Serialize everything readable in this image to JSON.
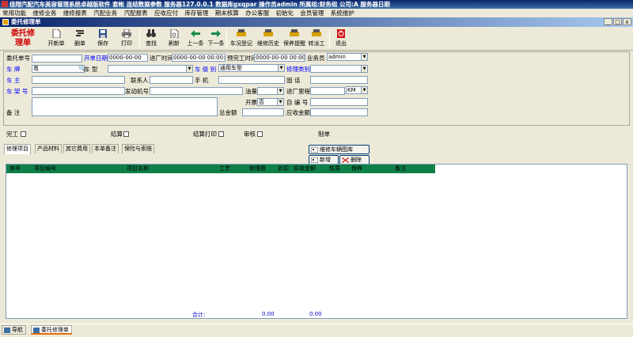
{
  "titlebar": {
    "text": "佳翔汽配汽车美容管理系统卓越版软件   套帐 连结数据参数    服务器127.0.0.1   数据库gxqpar  操作员admin  所属组:财务组   公司:A   服务器日期"
  },
  "menu": [
    "常用功能",
    "维修业务",
    "维修报表",
    "汽配业务",
    "汽配报表",
    "应收应付",
    "库存管理",
    "期末核算",
    "办公客服",
    "初始化",
    "会员管理",
    "系统维护"
  ],
  "window": {
    "title": "委托修理单",
    "controls": [
      "_",
      "□",
      "x"
    ]
  },
  "toolbar": {
    "brand": "委托修\n理单",
    "buttons": [
      {
        "label": "开新单",
        "icon": "new-doc-icon"
      },
      {
        "label": "删单",
        "icon": "delete-doc-icon"
      },
      {
        "label": "保存",
        "icon": "save-icon"
      },
      {
        "label": "打印",
        "icon": "print-icon"
      },
      {
        "label": "查找",
        "icon": "binoculars-icon"
      },
      {
        "label": "刷新",
        "icon": "refresh-icon"
      },
      {
        "label": "上一条",
        "icon": "arrow-left-icon"
      },
      {
        "label": "下一条",
        "icon": "arrow-right-icon"
      },
      {
        "label": "车况登记",
        "icon": "car-check-icon"
      },
      {
        "label": "维修历史",
        "icon": "history-icon"
      },
      {
        "label": "保养提醒",
        "icon": "reminder-icon"
      },
      {
        "label": "转派工",
        "icon": "dispatch-icon"
      },
      {
        "label": "退出",
        "icon": "exit-icon"
      }
    ]
  },
  "form": {
    "order_no_label": "委托单号",
    "open_date_label": "开单日期",
    "open_date_value": "0000-00-00",
    "entry_time_label": "进厂时间",
    "entry_time_value": "0000-00-00 00:00:00",
    "est_done_label": "预完工时间",
    "est_done_value": "0000-00-00 00:00",
    "clerk_label": "业务员",
    "clerk_value": "admin",
    "plate_label": "车    牌",
    "plate_prefix": "粤",
    "model_label": "车    型",
    "level_label": "车 级 别",
    "level_value": "通用车型",
    "repair_type_label": "修理类别",
    "owner_label": "车    主",
    "contact_label": "联系人",
    "phone_label": "手    机",
    "tel_label": "固    话",
    "vin_label": "车 架 号",
    "engine_label": "发动机号",
    "fuel_label": "油量",
    "mileage_label": "进厂里程",
    "mileage_unit": "KM",
    "invoice_label": "开票",
    "invoice_value": "否",
    "self_no_label": "自 编 号",
    "remark_label": "备    注",
    "total_label": "总金额",
    "receivable_label": "应收金额"
  },
  "checks": [
    {
      "label": "完工"
    },
    {
      "label": "结算"
    },
    {
      "label": "结算打印"
    },
    {
      "label": "审核"
    },
    {
      "label": "制单"
    }
  ],
  "tabs": [
    "修理项目",
    "产品材料",
    "其它费用",
    "本单备注",
    "保险与索赔"
  ],
  "actions": {
    "library": "维修车辆图库",
    "add": "新增",
    "delete": "删除"
  },
  "grid": {
    "columns": [
      "序号",
      "项目编号",
      "项目名称",
      "工艺",
      "修理费",
      "折扣",
      "实收金额",
      "性质",
      "保养",
      "备注"
    ]
  },
  "totals": {
    "label": "合计:",
    "repair_fee": "0.00",
    "actual": "0.00"
  },
  "statusbar": {
    "items": [
      "导航",
      "委托修理单"
    ]
  },
  "colors": {
    "brand_red": "#d00000",
    "label_blue": "#0000ff",
    "grid_header": "#0f8048"
  }
}
